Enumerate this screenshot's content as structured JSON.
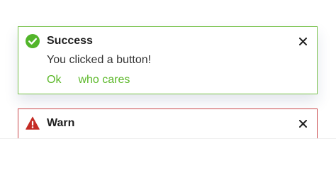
{
  "colors": {
    "success": "#77c14a",
    "warn": "#c9474b",
    "action_link": "#5cb82a"
  },
  "success_toast": {
    "icon": "check-circle-icon",
    "title": "Success",
    "message": "You clicked a button!",
    "actions": [
      {
        "label": "Ok"
      },
      {
        "label": "who cares"
      }
    ],
    "close_icon": "close-icon"
  },
  "warn_toast": {
    "icon": "warning-triangle-icon",
    "title": "Warn",
    "close_icon": "close-icon"
  }
}
